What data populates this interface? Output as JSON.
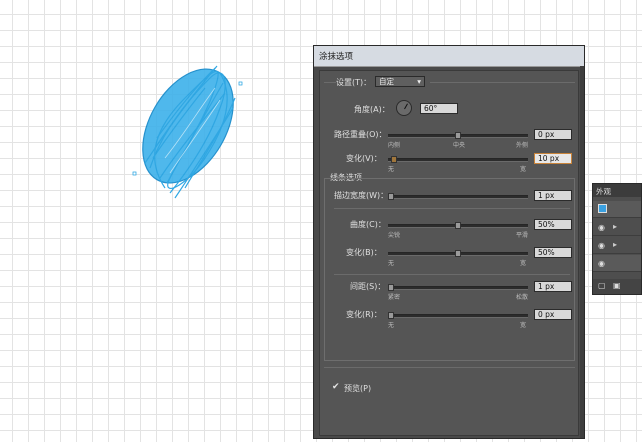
{
  "dialog": {
    "title": "涂抹选项",
    "settings_label": "设置(T)：",
    "settings_value": "自定",
    "angle_label": "角度(A)：",
    "angle_value": "60°",
    "path_overlap_label": "路径重叠(O)：",
    "path_overlap_value": "0 px",
    "path_overlap_ticks": [
      "内侧",
      "中央",
      "外侧"
    ],
    "variation1_label": "变化(V)：",
    "variation1_value": "10 px",
    "variation1_ticks": [
      "无",
      "宽"
    ],
    "line_options_title": "线条选项",
    "stroke_width_label": "描边宽度(W)：",
    "stroke_width_value": "1 px",
    "curviness_label": "曲度(C)：",
    "curviness_value": "50%",
    "curviness_ticks": [
      "尖锐",
      "平滑"
    ],
    "variation2_label": "变化(B)：",
    "variation2_value": "50%",
    "variation2_ticks": [
      "无",
      "宽"
    ],
    "spacing_label": "间距(S)：",
    "spacing_value": "1 px",
    "spacing_ticks": [
      "紧密",
      "松散"
    ],
    "variation3_label": "变化(R)：",
    "variation3_value": "0 px",
    "variation3_ticks": [
      "无",
      "宽"
    ],
    "preview_label": "预览(P)",
    "preview_checked": true,
    "sliders": {
      "path_overlap": 0.5,
      "variation1": 0.02,
      "stroke_width": 0.0,
      "curviness": 0.5,
      "variation2": 0.5,
      "spacing": 0.0,
      "variation3": 0.0
    }
  },
  "panel": {
    "title": "外观"
  },
  "colors": {
    "dialog_bg": "#4a4a4a",
    "scribble": "#1a9ee0",
    "field_active_border": "#c9843a"
  }
}
